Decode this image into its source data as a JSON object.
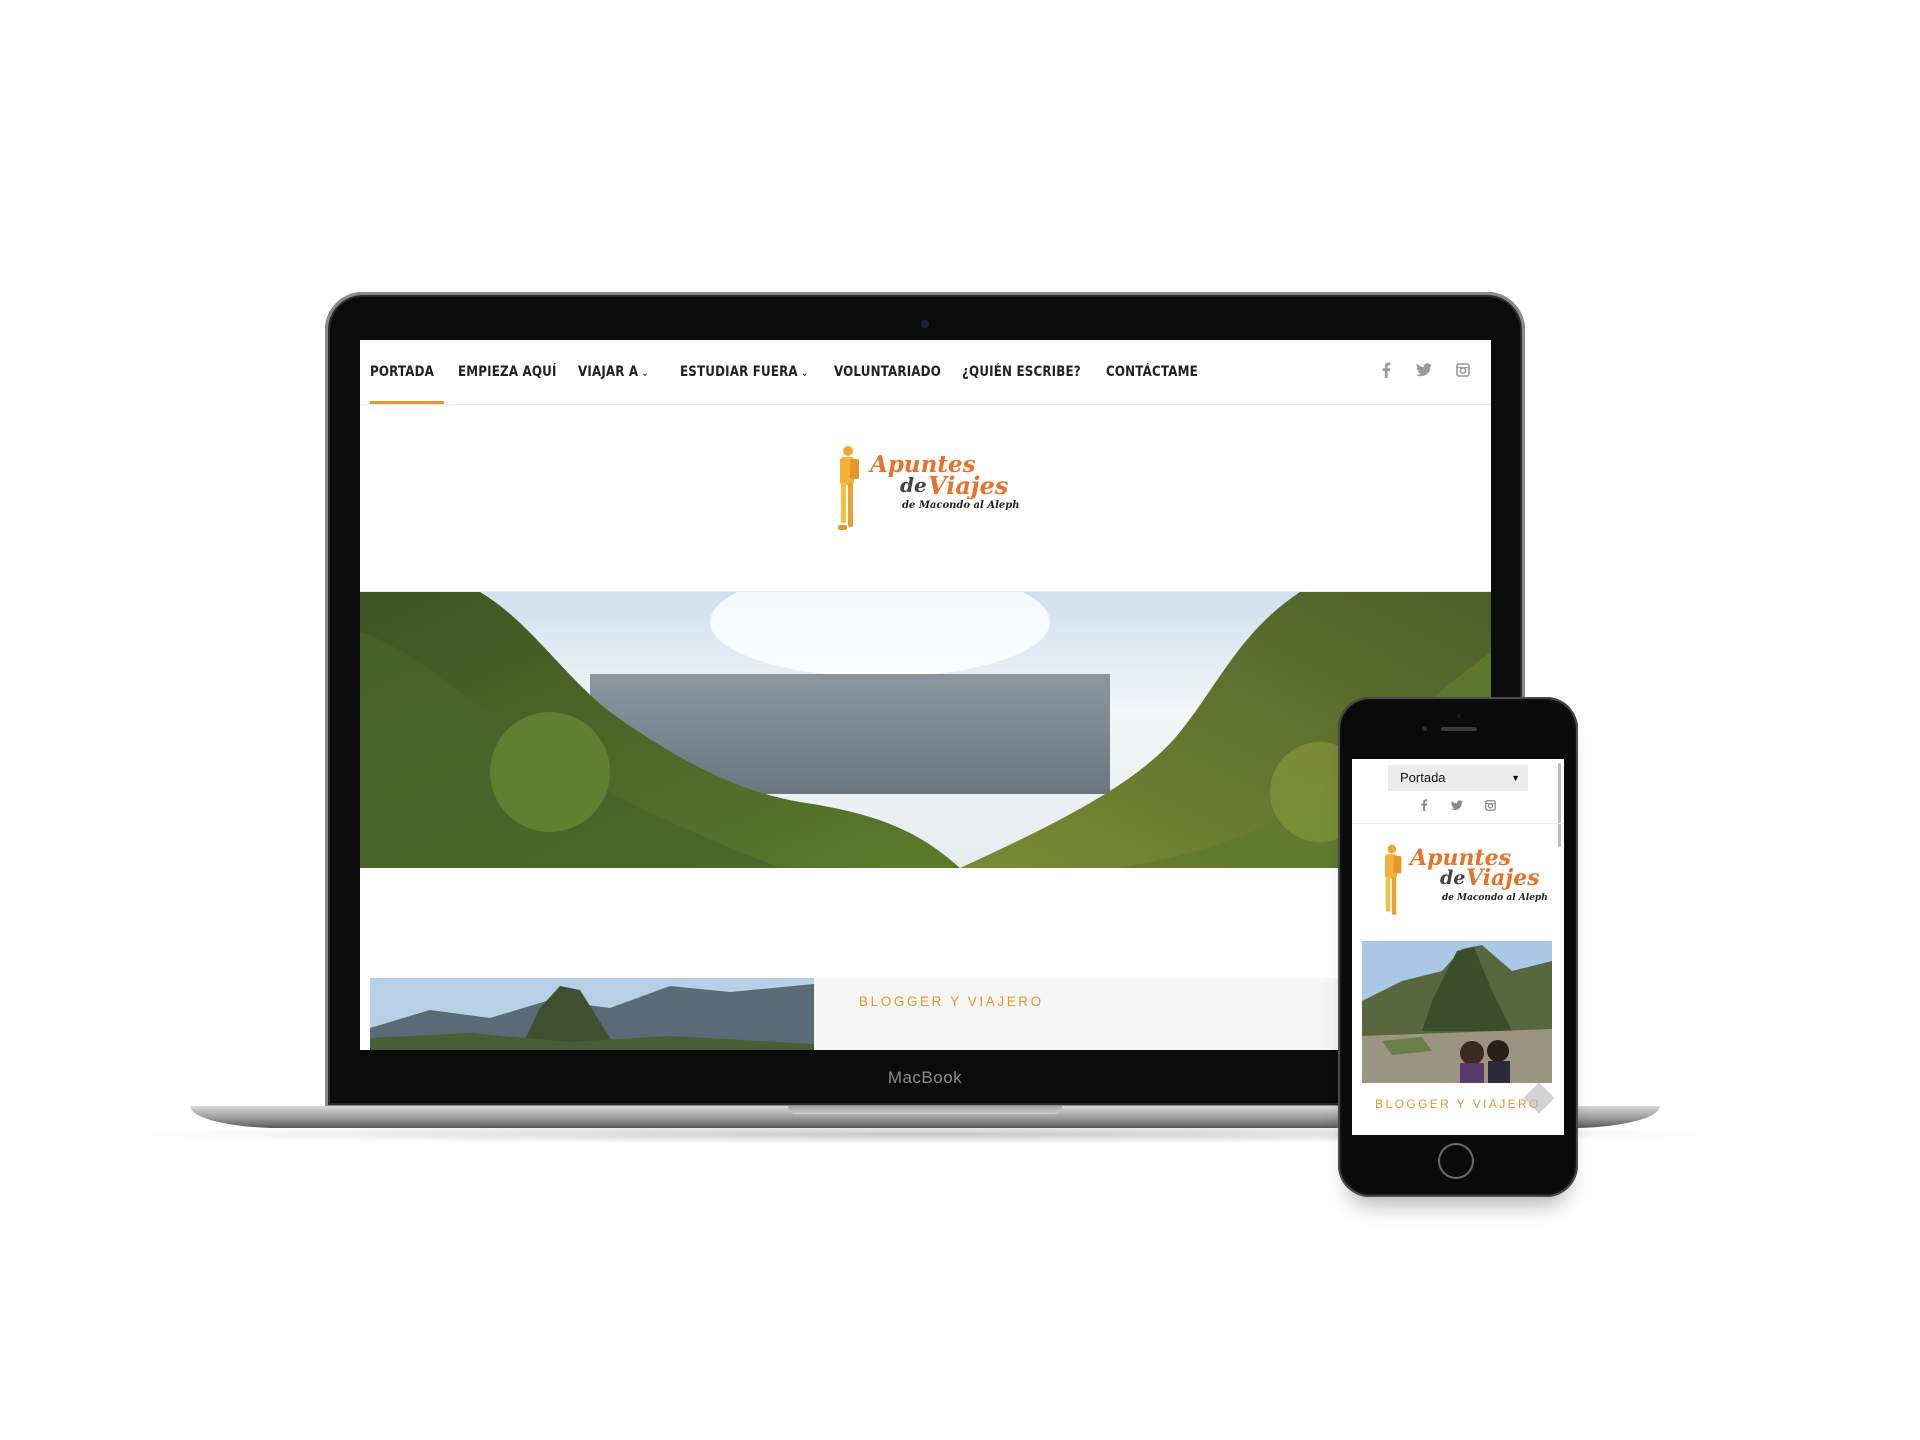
{
  "desktop": {
    "nav": {
      "items": [
        {
          "label": "PORTADA",
          "active": true
        },
        {
          "label": "EMPIEZA AQUÍ",
          "active": false
        },
        {
          "label": "VIAJAR A",
          "active": false,
          "dropdown": true
        },
        {
          "label": "ESTUDIAR FUERA",
          "active": false,
          "dropdown": true
        },
        {
          "label": "VOLUNTARIADO",
          "active": false
        },
        {
          "label": "¿QUIÉN ESCRIBE?",
          "active": false
        },
        {
          "label": "CONTÁCTAME",
          "active": false
        }
      ],
      "social_icons": [
        "facebook-icon",
        "twitter-icon",
        "instagram-icon"
      ]
    },
    "logo": {
      "word1": "Apuntes",
      "word_de": "de",
      "word2": "Viajes",
      "subtitle": "de Macondo al Aleph"
    },
    "feature": {
      "label": "BLOGGER Y VIAJERO"
    }
  },
  "laptop": {
    "brand": "MacBook"
  },
  "mobile": {
    "select_value": "Portada",
    "social_icons": [
      "facebook-icon",
      "twitter-icon",
      "instagram-icon"
    ],
    "logo": {
      "word1": "Apuntes",
      "word_de": "de",
      "word2": "Viajes",
      "subtitle": "de Macondo al Aleph"
    },
    "feature_label": "BLOGGER Y VIAJERO"
  },
  "colors": {
    "accent": "#e8962a",
    "logo_orange": "#e8722a",
    "nav_text": "#222222",
    "social_grey": "#9a9a9a"
  }
}
